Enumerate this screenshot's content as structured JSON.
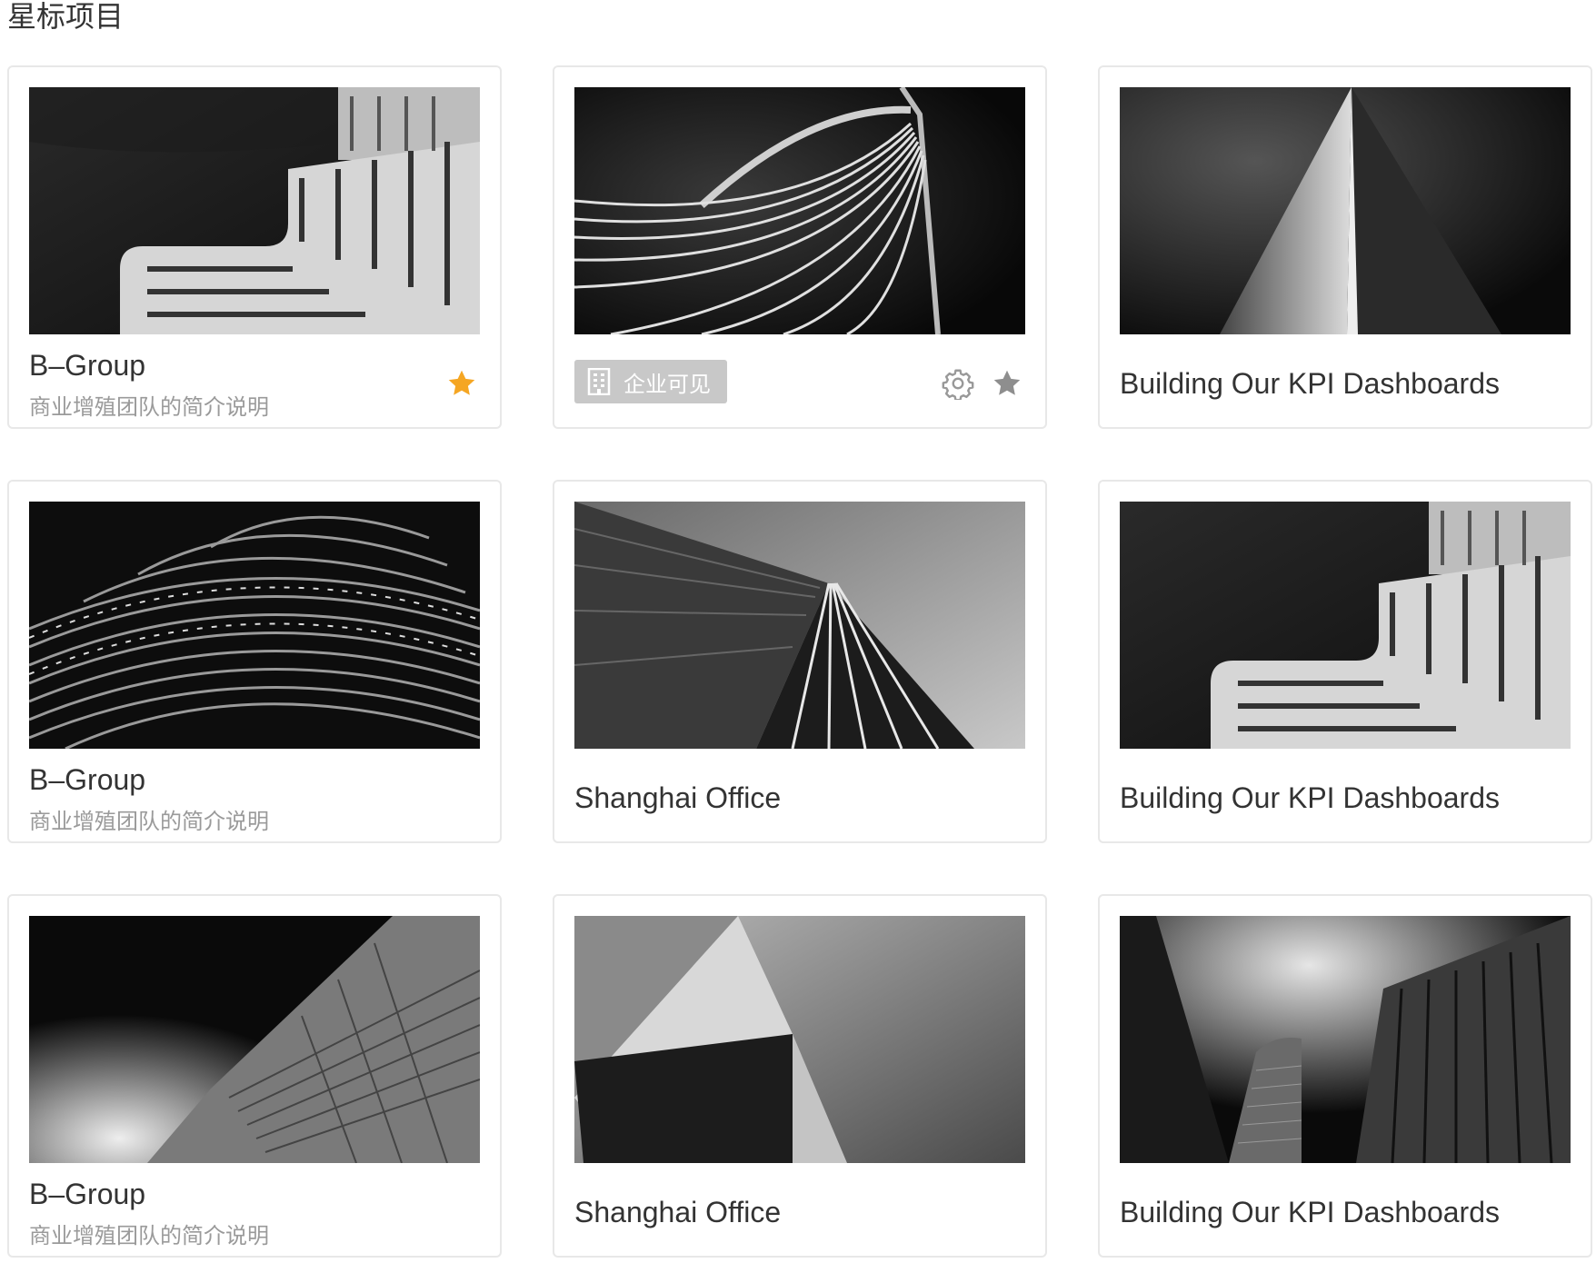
{
  "section_title": "星标项目",
  "cards": [
    {
      "title": "B–Group",
      "desc": "商业增殖团队的简介说明",
      "starred": true,
      "accent": "#f5a623"
    },
    {
      "badge": "企业可见",
      "starred": false
    },
    {
      "title": "Building Our KPI Dashboards"
    },
    {
      "title": "B–Group",
      "desc": "商业增殖团队的简介说明"
    },
    {
      "title": "Shanghai Office"
    },
    {
      "title": "Building Our KPI Dashboards"
    },
    {
      "title": "B–Group",
      "desc": "商业增殖团队的简介说明"
    },
    {
      "title": "Shanghai Office"
    },
    {
      "title": "Building Our KPI Dashboards"
    }
  ],
  "icons": {
    "star": "star-icon",
    "gear": "gear-icon",
    "building": "building-icon"
  }
}
